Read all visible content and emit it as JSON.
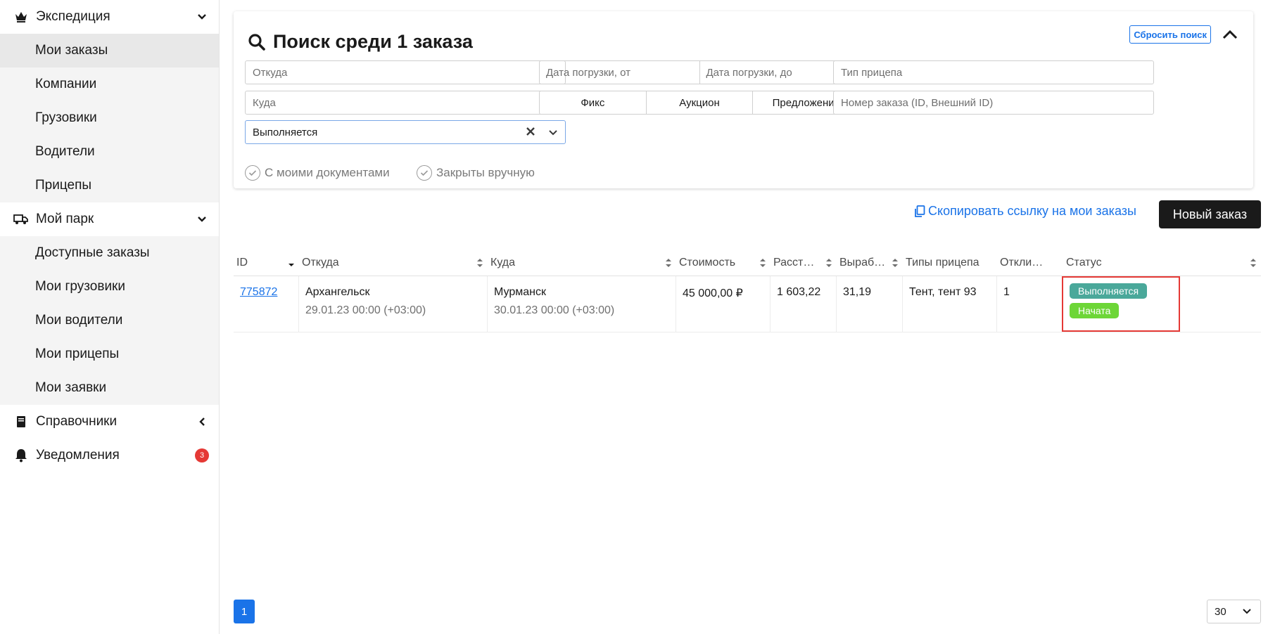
{
  "sidebar": {
    "groups": [
      {
        "label": "Экспедиция",
        "icon": "crown-icon",
        "items": [
          {
            "label": "Мои заказы",
            "active": true
          },
          {
            "label": "Компании"
          },
          {
            "label": "Грузовики"
          },
          {
            "label": "Водители"
          },
          {
            "label": "Прицепы"
          }
        ]
      },
      {
        "label": "Мой парк",
        "icon": "truck-icon",
        "items": [
          {
            "label": "Доступные заказы"
          },
          {
            "label": "Мои грузовики"
          },
          {
            "label": "Мои водители"
          },
          {
            "label": "Мои прицепы"
          },
          {
            "label": "Мои заявки"
          }
        ]
      },
      {
        "label": "Справочники",
        "icon": "book-icon"
      },
      {
        "label": "Уведомления",
        "icon": "bell-icon",
        "badge": "3"
      }
    ]
  },
  "search": {
    "title": "Поиск среди 1 заказа",
    "reset_label": "Сбросить поиск",
    "from_placeholder": "Откуда",
    "to_placeholder": "Куда",
    "status_value": "Выполняется",
    "date_from_placeholder": "Дата погрузки, от",
    "date_to_placeholder": "Дата погрузки, до",
    "segments": [
      "Фикс",
      "Аукцион",
      "Предложения"
    ],
    "trailer_type_placeholder": "Тип прицепа",
    "order_number_placeholder": "Номер заказа (ID, Внешний ID)",
    "checkbox_documents": "С моими документами",
    "checkbox_closed": "Закрыты вручную"
  },
  "toolbar": {
    "copy_link_label": "Скопировать ссылку на мои заказы",
    "new_order_label": "Новый заказ"
  },
  "table": {
    "headers": [
      "ID",
      "Откуда",
      "Куда",
      "Стоимость",
      "Расст…",
      "Выраб…",
      "Типы прицепа",
      "Откли…",
      "Статус"
    ],
    "rows": [
      {
        "id": "775872",
        "from_city": "Архангельск",
        "from_date": "29.01.23 00:00 (+03:00)",
        "to_city": "Мурманск",
        "to_date": "30.01.23 00:00 (+03:00)",
        "cost": "45 000,00 ₽",
        "distance": "1 603,22",
        "output": "31,19",
        "trailer_types": "Тент, тент 93",
        "responses": "1",
        "status_primary": "Выполняется",
        "status_secondary": "Начата"
      }
    ]
  },
  "pagination": {
    "current_page": "1",
    "per_page": "30"
  },
  "colors": {
    "accent": "#1a73e8",
    "status_teal": "#4aa89a",
    "status_green": "#6dd637",
    "highlight": "#e53935"
  }
}
